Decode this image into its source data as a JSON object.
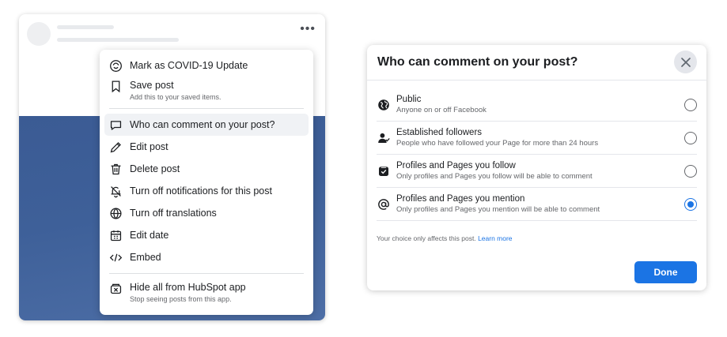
{
  "menu": {
    "items": [
      {
        "label": "Mark as COVID-19 Update",
        "icon": "covid-update-icon"
      },
      {
        "label": "Save post",
        "sublabel": "Add this to your saved items.",
        "icon": "bookmark-icon"
      },
      {
        "label": "Who can comment on your post?",
        "icon": "comment-icon"
      },
      {
        "label": "Edit post",
        "icon": "pencil-icon"
      },
      {
        "label": "Delete post",
        "icon": "trash-icon"
      },
      {
        "label": "Turn off notifications for this post",
        "icon": "bell-off-icon"
      },
      {
        "label": "Turn off translations",
        "icon": "translate-icon"
      },
      {
        "label": "Edit date",
        "icon": "calendar-icon"
      },
      {
        "label": "Embed",
        "icon": "code-icon"
      },
      {
        "label": "Hide all from HubSpot app",
        "sublabel": "Stop seeing posts from this app.",
        "icon": "hide-app-icon"
      }
    ]
  },
  "dialog": {
    "title": "Who can comment on your post?",
    "options": [
      {
        "label": "Public",
        "sublabel": "Anyone on or off Facebook",
        "icon": "globe-icon",
        "selected": false
      },
      {
        "label": "Established followers",
        "sublabel": "People who have followed your Page for more than 24 hours",
        "icon": "followers-icon",
        "selected": false
      },
      {
        "label": "Profiles and Pages you follow",
        "sublabel": "Only profiles and Pages you follow will be able to comment",
        "icon": "follow-check-icon",
        "selected": false
      },
      {
        "label": "Profiles and Pages you mention",
        "sublabel": "Only profiles and Pages you mention will be able to comment",
        "icon": "at-icon",
        "selected": true
      }
    ],
    "footnote": "Your choice only affects this post.",
    "learn_more": "Learn more",
    "done_label": "Done"
  },
  "colors": {
    "accent": "#1b74e4",
    "post_image": "#3e6099"
  }
}
